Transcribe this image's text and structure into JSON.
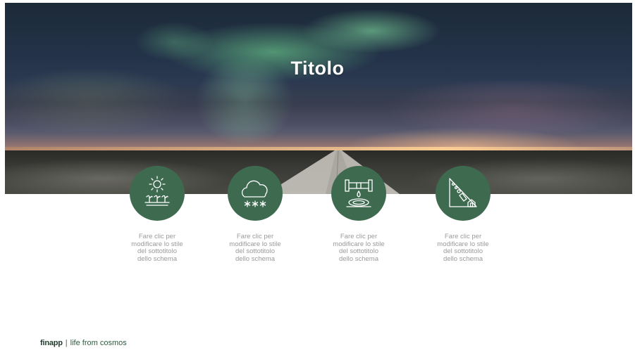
{
  "slide": {
    "title": "Titolo",
    "items": [
      {
        "icon": "sun-crops-icon",
        "caption_lines": [
          "Fare clic per",
          "modificare lo stile",
          "del sottotitolo",
          "dello schema"
        ]
      },
      {
        "icon": "snow-cloud-icon",
        "caption_lines": [
          "Fare clic per",
          "modificare lo stile",
          "del sottotitolo",
          "dello schema"
        ]
      },
      {
        "icon": "pipe-leak-icon",
        "caption_lines": [
          "Fare clic per",
          "modificare lo stile",
          "del sottotitolo",
          "dello schema"
        ]
      },
      {
        "icon": "landslide-house-icon",
        "caption_lines": [
          "Fare clic per",
          "modificare lo stile",
          "del sottotitolo",
          "dello schema"
        ]
      }
    ]
  },
  "footer": {
    "brand": "finapp",
    "separator": "|",
    "tagline": "life from cosmos"
  },
  "colors": {
    "accent_green": "#3e6b50",
    "caption_gray": "#9a9a9a",
    "footer_green": "#2e5a3e"
  }
}
